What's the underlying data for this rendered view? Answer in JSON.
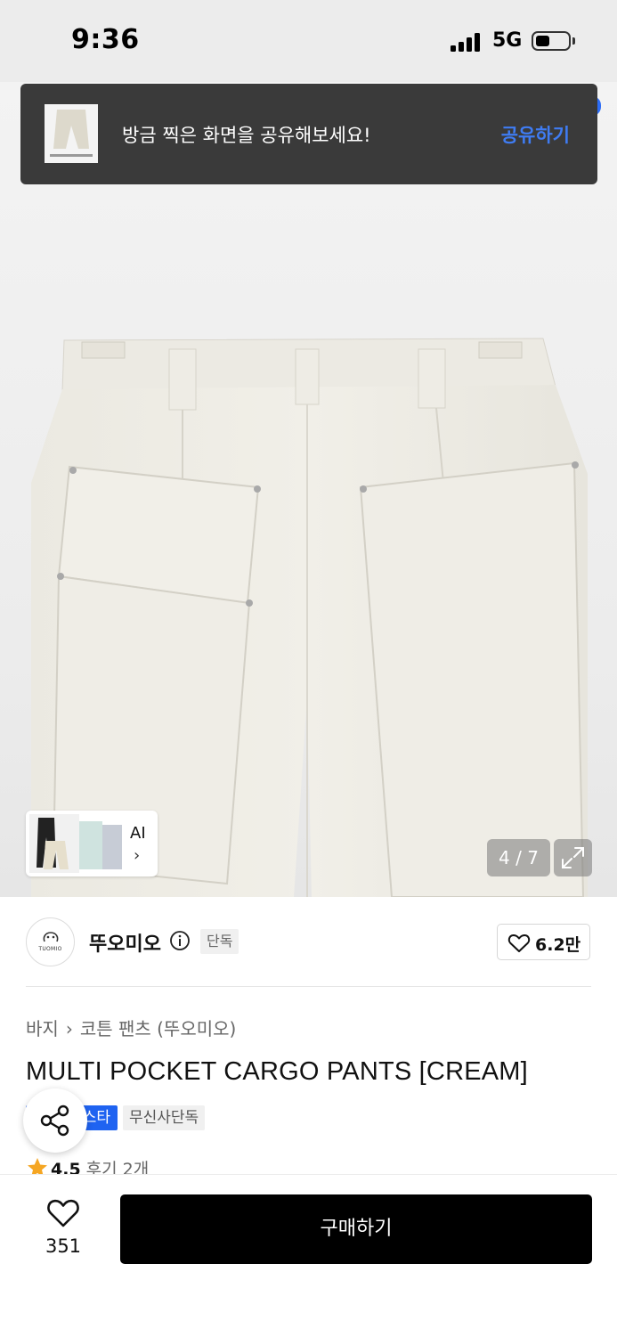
{
  "status_bar": {
    "time": "9:36",
    "network": "5G",
    "battery_level": 0.45
  },
  "share_toast": {
    "message": "방금 찍은 화면을 공유해보세요!",
    "action": "공유하기"
  },
  "gallery": {
    "ai_chip_label": "AI",
    "current_image": 4,
    "total_images": 7,
    "counter_text": "4 / 7"
  },
  "brand": {
    "name": "뚜오미오",
    "logo_text": "TUOMIO",
    "badge": "단독",
    "likes": "6.2만"
  },
  "product": {
    "breadcrumb": [
      "바지",
      "코튼 팬츠 (뚜오미오)"
    ],
    "title": "MULTI POCKET CARGO PANTS [CREAM]",
    "tags": [
      "스타",
      "무신사단독"
    ],
    "rating": "4.5",
    "reviews": "후기 2개"
  },
  "bottom_bar": {
    "wish_count": "351",
    "buy_label": "구매하기"
  },
  "colors": {
    "accent_blue": "#1f63f1",
    "toast_link": "#3f7cf3",
    "star": "#f5a623"
  }
}
